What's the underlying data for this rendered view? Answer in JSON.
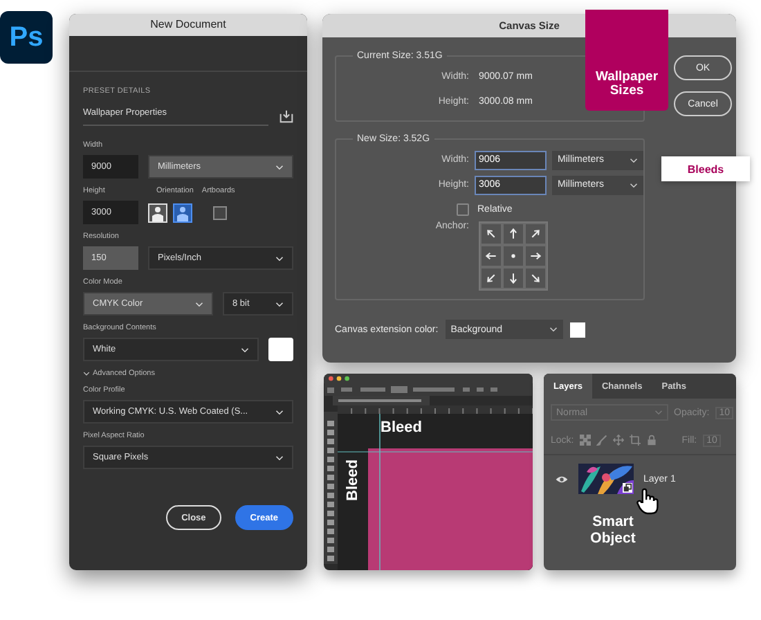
{
  "app_logo": {
    "text": "Ps"
  },
  "new_document": {
    "title": "New Document",
    "preset_heading": "PRESET DETAILS",
    "preset_name": "Wallpaper Properties",
    "width": {
      "label": "Width",
      "value": "9000",
      "unit": "Millimeters",
      "unit_highlighted": true
    },
    "height": {
      "label": "Height",
      "value": "3000"
    },
    "orientation": {
      "label": "Orientation",
      "options": [
        {
          "selected": false
        },
        {
          "selected": true
        }
      ]
    },
    "artboards": {
      "label": "Artboards",
      "checked": false
    },
    "resolution": {
      "label": "Resolution",
      "value": "150",
      "value_highlighted": true,
      "unit": "Pixels/Inch"
    },
    "color_mode": {
      "label": "Color Mode",
      "mode": "CMYK Color",
      "mode_highlighted": true,
      "depth": "8 bit"
    },
    "background": {
      "label": "Background Contents",
      "value": "White"
    },
    "advanced": {
      "label": "Advanced Options",
      "expanded": true
    },
    "color_profile": {
      "label": "Color Profile",
      "value": "Working CMYK: U.S. Web Coated (S..."
    },
    "pixel_aspect": {
      "label": "Pixel Aspect Ratio",
      "value": "Square Pixels"
    },
    "buttons": [
      {
        "label": "Close",
        "kind": "secondary"
      },
      {
        "label": "Create",
        "kind": "primary"
      }
    ]
  },
  "canvas_size": {
    "title": "Canvas Size",
    "current": {
      "heading": "Current Size: 3.51G",
      "rows": [
        {
          "label": "Width:",
          "value": "9000.07 mm"
        },
        {
          "label": "Height:",
          "value": "3000.08 mm"
        }
      ]
    },
    "new": {
      "heading": "New Size: 3.52G",
      "rows": [
        {
          "label": "Width:",
          "value": "9006",
          "unit": "Millimeters"
        },
        {
          "label": "Height:",
          "value": "3006",
          "unit": "Millimeters"
        }
      ],
      "relative": {
        "label": "Relative",
        "checked": false
      },
      "anchor_label": "Anchor:"
    },
    "extension": {
      "label": "Canvas extension color:",
      "value": "Background"
    },
    "buttons": [
      {
        "label": "OK"
      },
      {
        "label": "Cancel"
      }
    ]
  },
  "callouts": [
    {
      "kind": "tag",
      "text": "Wallpaper Sizes"
    },
    {
      "kind": "label",
      "text": "Bleeds"
    },
    {
      "kind": "pointer",
      "text": "Smart Object"
    }
  ],
  "canvas_window": {
    "bleed_top": "Bleed",
    "bleed_side": "Bleed"
  },
  "layers_panel": {
    "tabs": [
      {
        "label": "Layers",
        "selected": true
      },
      {
        "label": "Channels",
        "selected": false
      },
      {
        "label": "Paths",
        "selected": false
      }
    ],
    "blend_mode": "Normal",
    "opacity_label": "Opacity:",
    "opacity_value": "10",
    "lock_label": "Lock:",
    "fill_label": "Fill:",
    "fill_value": "10",
    "layers": [
      {
        "name": "Layer 1",
        "visible": true,
        "smart_object": true
      }
    ]
  }
}
